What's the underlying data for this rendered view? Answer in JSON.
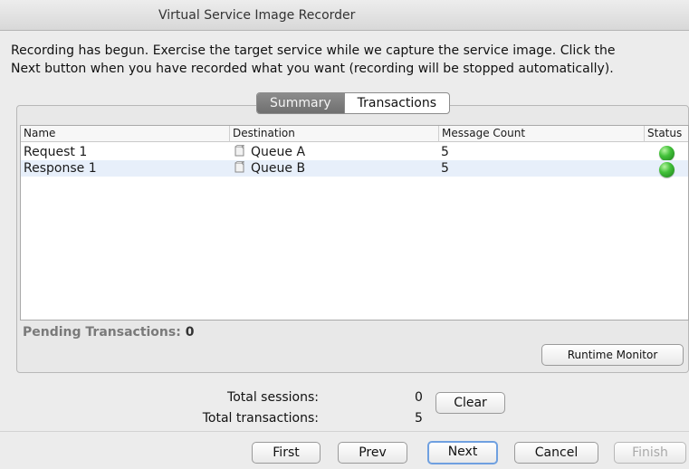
{
  "window": {
    "title": "Virtual Service Image Recorder"
  },
  "instructions": {
    "line1": "Recording has begun.  Exercise the target service while we capture the service image.  Click the",
    "line2": "Next button when you have recorded what you want (recording will be stopped automatically)."
  },
  "tabs": [
    {
      "label": "Summary",
      "active": true
    },
    {
      "label": "Transactions",
      "active": false
    }
  ],
  "table": {
    "columns": [
      "Name",
      "Destination",
      "Message Count",
      "Status"
    ],
    "rows": [
      {
        "name": "Request 1",
        "destination": "Queue A",
        "count": "5",
        "status": "green",
        "icon": "queue-icon"
      },
      {
        "name": "Response 1",
        "destination": "Queue B",
        "count": "5",
        "status": "green",
        "icon": "queue-icon"
      }
    ]
  },
  "pending": {
    "label": "Pending Transactions:",
    "value": "0"
  },
  "runtime_monitor_label": "Runtime Monitor",
  "totals": {
    "sessions_label": "Total sessions:",
    "sessions_value": "0",
    "transactions_label": "Total transactions:",
    "transactions_value": "5"
  },
  "clear_label": "Clear",
  "nav": {
    "first": "First",
    "prev": "Prev",
    "next": "Next",
    "cancel": "Cancel",
    "finish": "Finish"
  },
  "colors": {
    "status_green": "#43c13a",
    "selected_row": "#e7effa",
    "active_tab": "#7d7d7d",
    "focus_ring": "#6fa0e0"
  }
}
